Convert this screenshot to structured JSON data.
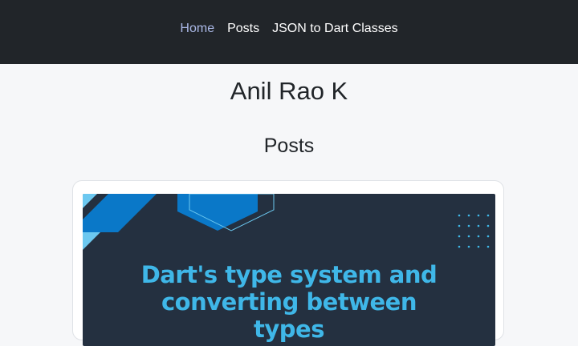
{
  "nav": {
    "items": [
      {
        "label": "Home",
        "active": true
      },
      {
        "label": "Posts",
        "active": false
      },
      {
        "label": "JSON to Dart Classes",
        "active": false
      }
    ]
  },
  "site": {
    "title": "Anil Rao K"
  },
  "posts_section": {
    "title": "Posts"
  },
  "post": {
    "image_title_line1": "Dart's type system and",
    "image_title_line2": "converting between",
    "image_title_line3": "types"
  },
  "colors": {
    "navbar_bg": "#212529",
    "nav_active": "#aab8e6",
    "image_bg": "#243040",
    "image_text": "#3fb7e8",
    "accent_blue": "#0a78c8",
    "light_blue": "#6cc8f0"
  }
}
